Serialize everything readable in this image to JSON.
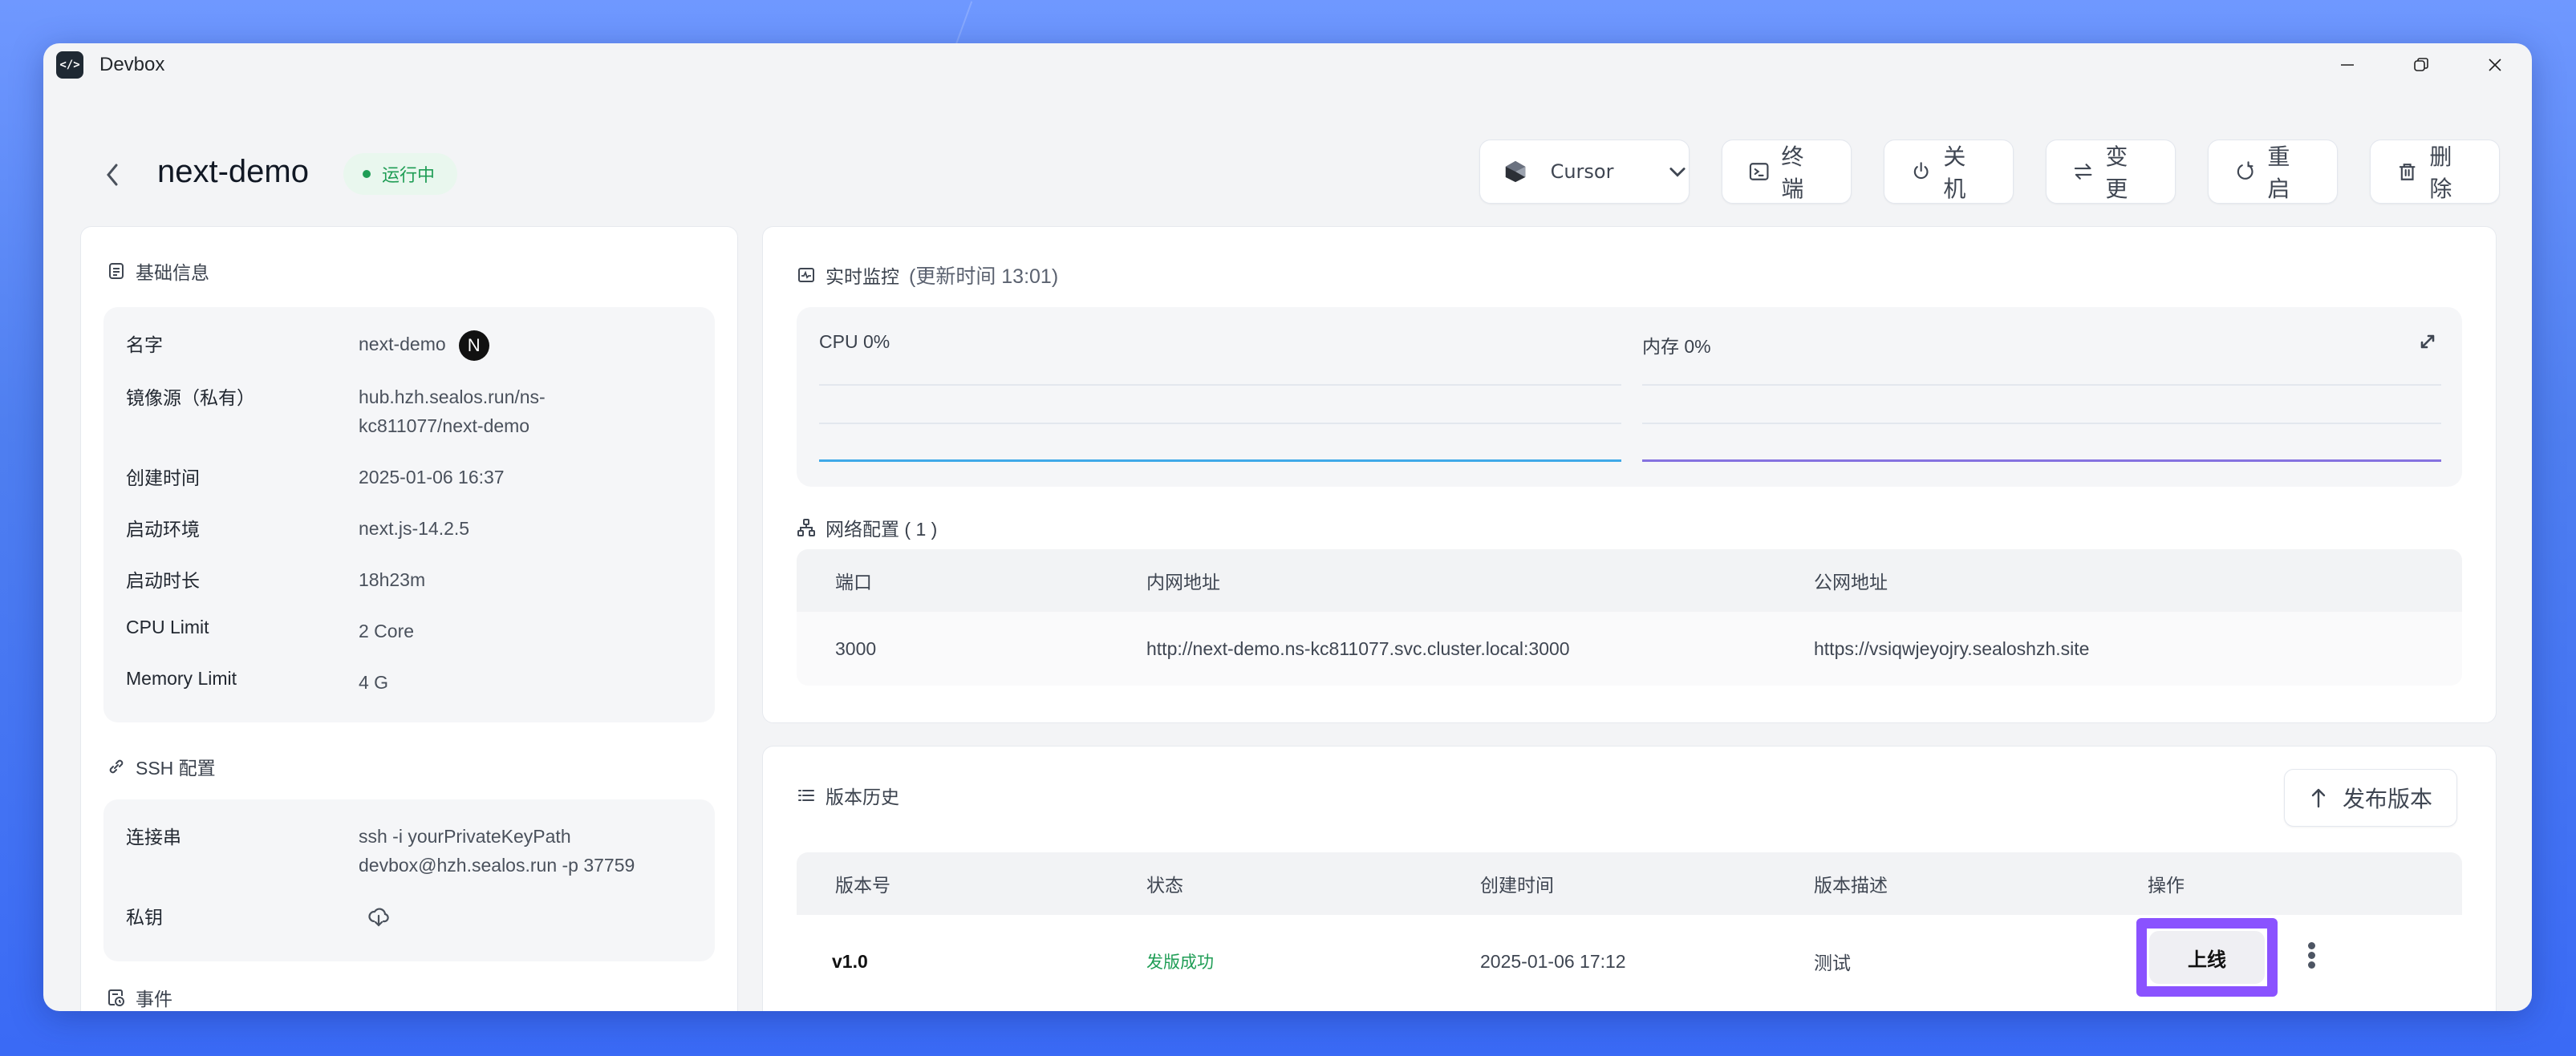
{
  "window": {
    "app_title": "Devbox",
    "controls": {
      "minimize": "minimize-icon",
      "restore": "restore-icon",
      "close": "close-icon"
    }
  },
  "header": {
    "title": "next-demo",
    "status": "运行中",
    "status_color": "#1f9d55",
    "ide": {
      "label": "Cursor",
      "icon": "cursor-logo-icon"
    },
    "actions": [
      {
        "label": "终端",
        "icon": "terminal-icon"
      },
      {
        "label": "关机",
        "icon": "power-icon"
      },
      {
        "label": "变更",
        "icon": "swap-icon"
      },
      {
        "label": "重启",
        "icon": "restart-icon"
      },
      {
        "label": "删除",
        "icon": "trash-icon"
      }
    ]
  },
  "basic_info": {
    "title": "基础信息",
    "rows": [
      {
        "key": "名字",
        "value": "next-demo"
      },
      {
        "key": "镜像源（私有）",
        "value_line1": "hub.hzh.sealos.run/ns-",
        "value_line2": "kc811077/next-demo"
      },
      {
        "key": "创建时间",
        "value": "2025-01-06 16:37"
      },
      {
        "key": "启动环境",
        "value": "next.js-14.2.5"
      },
      {
        "key": "启动时长",
        "value": "18h23m"
      },
      {
        "key": "CPU Limit",
        "value": "2 Core"
      },
      {
        "key": "Memory Limit",
        "value": "4 G"
      }
    ]
  },
  "ssh": {
    "title": "SSH 配置",
    "rows": [
      {
        "key": "连接串",
        "value_line1": "ssh -i yourPrivateKeyPath",
        "value_line2": "devbox@hzh.sealos.run -p 37759"
      },
      {
        "key": "私钥",
        "icon": "cloud-download-icon"
      }
    ]
  },
  "events": {
    "title": "事件"
  },
  "monitor": {
    "title": "实时监控",
    "updated": "(更新时间  13:01)",
    "cpu": {
      "label": "CPU 0%",
      "value_percent": 0,
      "color": "#3fa9e8"
    },
    "memory": {
      "label": "内存 0%",
      "value_percent": 0,
      "color": "#8572e0"
    }
  },
  "network": {
    "title": "网络配置 ( 1 )",
    "columns": [
      "端口",
      "内网地址",
      "公网地址"
    ],
    "rows": [
      {
        "port": "3000",
        "internal": "http://next-demo.ns-kc811077.svc.cluster.local:3000",
        "public": "https://vsiqwjeyojry.sealoshzh.site"
      }
    ]
  },
  "versions": {
    "title": "版本历史",
    "publish_label": "发布版本",
    "columns": [
      "版本号",
      "状态",
      "创建时间",
      "版本描述",
      "操作"
    ],
    "rows": [
      {
        "version": "v1.0",
        "status": "发版成功",
        "status_color": "#1f9d55",
        "created": "2025-01-06 17:12",
        "description": "测试",
        "action": "上线"
      }
    ]
  }
}
